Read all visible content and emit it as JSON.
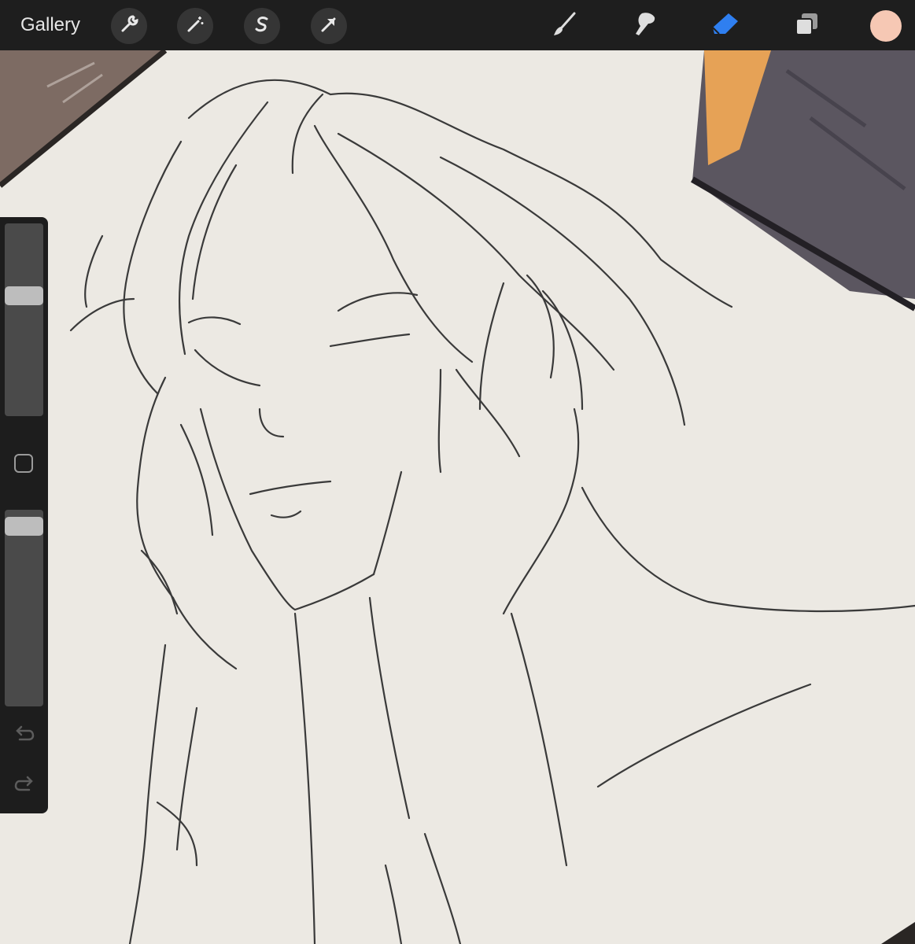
{
  "toolbar": {
    "gallery_label": "Gallery",
    "left_icons": [
      "wrench-icon",
      "magic-wand-icon",
      "selection-s-icon",
      "transform-arrow-icon"
    ],
    "right_tools": [
      "brush-icon",
      "smudge-icon",
      "eraser-icon",
      "layers-icon"
    ],
    "active_tool": "eraser",
    "accent_color": "#2f7ff0",
    "current_color": "#f6c8b4"
  },
  "sidebar": {
    "brush_size_level": 0.64,
    "opacity_level": 0.96,
    "controls": [
      "modify-button",
      "undo-icon",
      "redo-icon"
    ]
  },
  "canvas": {
    "content": "pencil-sketch",
    "paper_color": "#ece9e3"
  }
}
